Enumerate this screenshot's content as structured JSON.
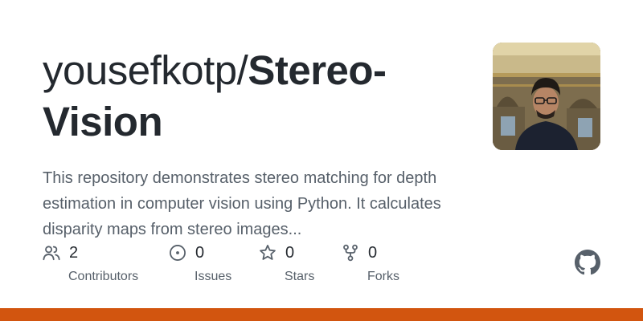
{
  "repo": {
    "owner_prefix": "yousefkotp/",
    "name": "Stereo-Vision",
    "description": "This repository demonstrates stereo matching for depth estimation in computer vision using Python. It calculates disparity maps from stereo images..."
  },
  "stats": [
    {
      "icon": "people-icon",
      "value": "2",
      "label": "Contributors"
    },
    {
      "icon": "issue-icon",
      "value": "0",
      "label": "Issues"
    },
    {
      "icon": "star-icon",
      "value": "0",
      "label": "Stars"
    },
    {
      "icon": "fork-icon",
      "value": "0",
      "label": "Forks"
    }
  ],
  "colors": {
    "accent": "#d2550f",
    "text_primary": "#24292f",
    "text_secondary": "#57606a",
    "icon": "#57606a"
  },
  "avatar": {
    "icon": "avatar-photo"
  },
  "logo": {
    "icon": "github-logo-icon"
  }
}
